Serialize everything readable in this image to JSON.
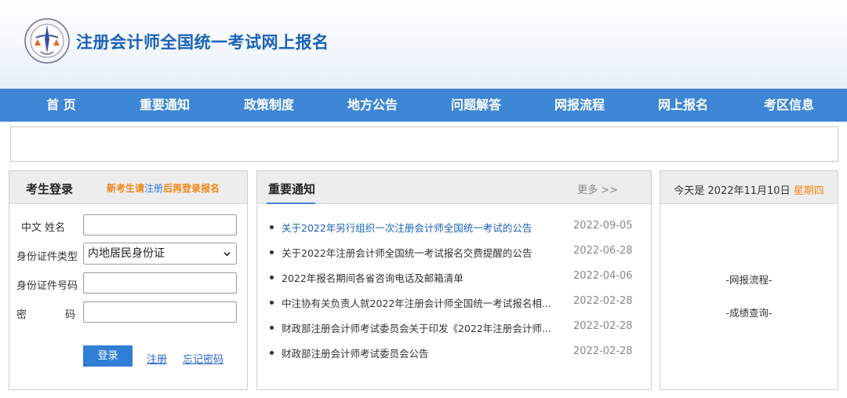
{
  "header": {
    "title": "注册会计师全国统一考试网上报名"
  },
  "nav": {
    "items": [
      "首 页",
      "重要通知",
      "政策制度",
      "地方公告",
      "问题解答",
      "网报流程",
      "网上报名",
      "考区信息"
    ]
  },
  "login": {
    "title": "考生登录",
    "hint_prefix": "新考生请",
    "hint_link": "注册",
    "hint_suffix": "后再登录报名",
    "name_label": "中文 姓名",
    "name_value": "",
    "idtype_label": "身份证件类型",
    "idtype_selected": "内地居民身份证",
    "idnum_label": "身份证件号码",
    "idnum_value": "",
    "pwd_label_1": "密",
    "pwd_label_2": "码",
    "pwd_value": "",
    "login_button": "登录",
    "register_link": "注册",
    "forgot_link": "忘记密码"
  },
  "news": {
    "title": "重要通知",
    "more": "更多 >>",
    "items": [
      {
        "text": "关于2022年另行组织一次注册会计师全国统一考试的公告",
        "date": "2022-09-05"
      },
      {
        "text": "关于2022年注册会计师全国统一考试报名交费提醒的公告",
        "date": "2022-06-28"
      },
      {
        "text": "2022年报名期间各省咨询电话及邮箱清单",
        "date": "2022-04-06"
      },
      {
        "text": "中注协有关负责人就2022年注册会计师全国统一考试报名相...",
        "date": "2022-02-28"
      },
      {
        "text": "财政部注册会计师考试委员会关于印发《2022年注册会计师...",
        "date": "2022-02-28"
      },
      {
        "text": "财政部注册会计师考试委员会公告",
        "date": "2022-02-28"
      }
    ]
  },
  "sidebar": {
    "date_prefix": "今天是 2022年11月10日",
    "weekday": "星期四",
    "link1": "-网报流程-",
    "link2": "-成绩查询-"
  },
  "colors": {
    "nav_bg": "#3e86d6",
    "title": "#1a62b8",
    "accent_orange": "#f08519",
    "button": "#2f7fd6"
  }
}
